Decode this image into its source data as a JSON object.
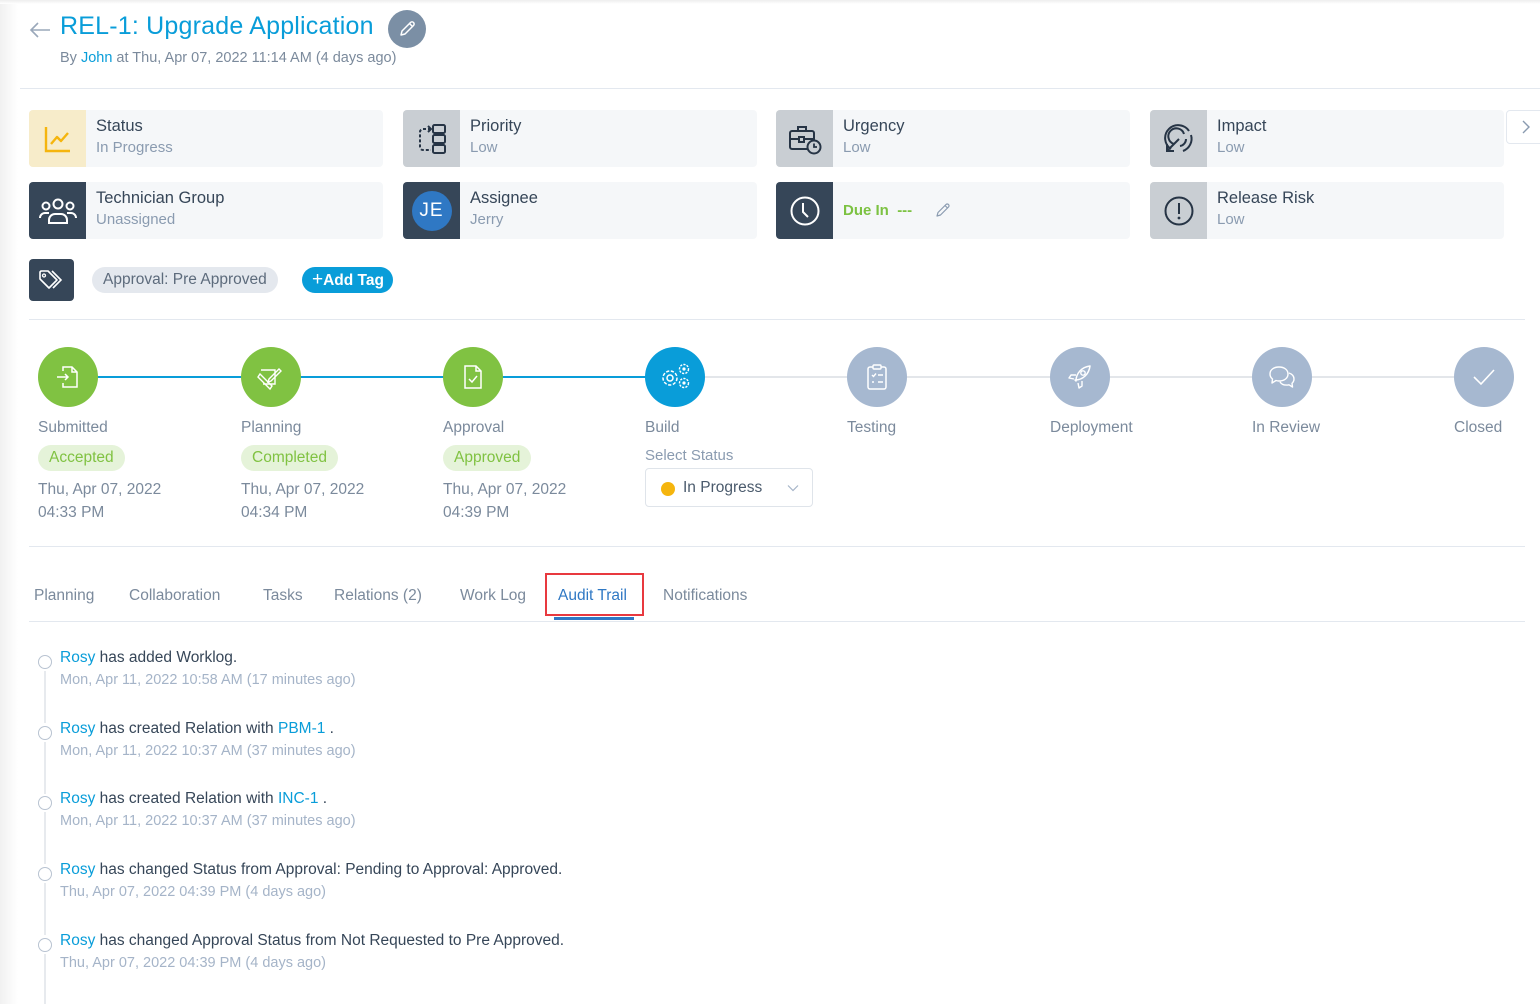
{
  "header": {
    "title": "REL-1: Upgrade Application",
    "by_prefix": "By ",
    "author": "John",
    "by_suffix": " at Thu, Apr 07, 2022 11:14 AM (4 days ago)"
  },
  "cards": {
    "status": {
      "label": "Status",
      "value": "In Progress"
    },
    "priority": {
      "label": "Priority",
      "value": "Low"
    },
    "urgency": {
      "label": "Urgency",
      "value": "Low"
    },
    "impact": {
      "label": "Impact",
      "value": "Low"
    },
    "technician_group": {
      "label": "Technician Group",
      "value": "Unassigned"
    },
    "assignee": {
      "label": "Assignee",
      "value": "Jerry",
      "initials": "JE"
    },
    "due": {
      "label": "Due In",
      "value": "---"
    },
    "release_risk": {
      "label": "Release Risk",
      "value": "Low"
    }
  },
  "tags": {
    "items": [
      "Approval: Pre Approved"
    ],
    "add_label": "Add Tag"
  },
  "stepper": {
    "steps": [
      {
        "name": "Submitted",
        "state": "done",
        "badge": "Accepted",
        "date": "Thu, Apr 07, 2022",
        "time": "04:33 PM"
      },
      {
        "name": "Planning",
        "state": "done",
        "badge": "Completed",
        "date": "Thu, Apr 07, 2022",
        "time": "04:34 PM"
      },
      {
        "name": "Approval",
        "state": "done",
        "badge": "Approved",
        "date": "Thu, Apr 07, 2022",
        "time": "04:39 PM"
      },
      {
        "name": "Build",
        "state": "current"
      },
      {
        "name": "Testing",
        "state": "todo"
      },
      {
        "name": "Deployment",
        "state": "todo"
      },
      {
        "name": "In Review",
        "state": "todo"
      },
      {
        "name": "Closed",
        "state": "todo"
      }
    ],
    "select_label": "Select Status",
    "selected_status": "In Progress",
    "status_color": "#f5b50e"
  },
  "tabs": [
    {
      "label": "Planning",
      "active": false
    },
    {
      "label": "Collaboration",
      "active": false
    },
    {
      "label": "Tasks",
      "active": false
    },
    {
      "label": "Relations (2)",
      "active": false
    },
    {
      "label": "Work Log",
      "active": false
    },
    {
      "label": "Audit Trail",
      "active": true
    },
    {
      "label": "Notifications",
      "active": false
    }
  ],
  "audit": [
    {
      "who": "Rosy",
      "text": " has added Worklog.",
      "ref": "",
      "after": "",
      "time": "Mon, Apr 11, 2022 10:58 AM (17 minutes ago)"
    },
    {
      "who": "Rosy",
      "text": " has created Relation with ",
      "ref": "PBM-1",
      "after": " .",
      "time": "Mon, Apr 11, 2022 10:37 AM (37 minutes ago)"
    },
    {
      "who": "Rosy",
      "text": " has created Relation with ",
      "ref": "INC-1",
      "after": " .",
      "time": "Mon, Apr 11, 2022 10:37 AM (37 minutes ago)"
    },
    {
      "who": "Rosy",
      "text": " has changed Status from Approval: Pending to Approval: Approved.",
      "ref": "",
      "after": "",
      "time": "Thu, Apr 07, 2022 04:39 PM (4 days ago)"
    },
    {
      "who": "Rosy",
      "text": " has changed Approval Status from Not Requested to Pre Approved.",
      "ref": "",
      "after": "",
      "time": "Thu, Apr 07, 2022 04:39 PM (4 days ago)"
    }
  ],
  "colors": {
    "brand": "#099dd9",
    "done": "#80c242",
    "todo": "#a6b8d0",
    "dark_tile": "#364658",
    "active_tab": "#2f78c4",
    "highlight": "#e8393f"
  }
}
